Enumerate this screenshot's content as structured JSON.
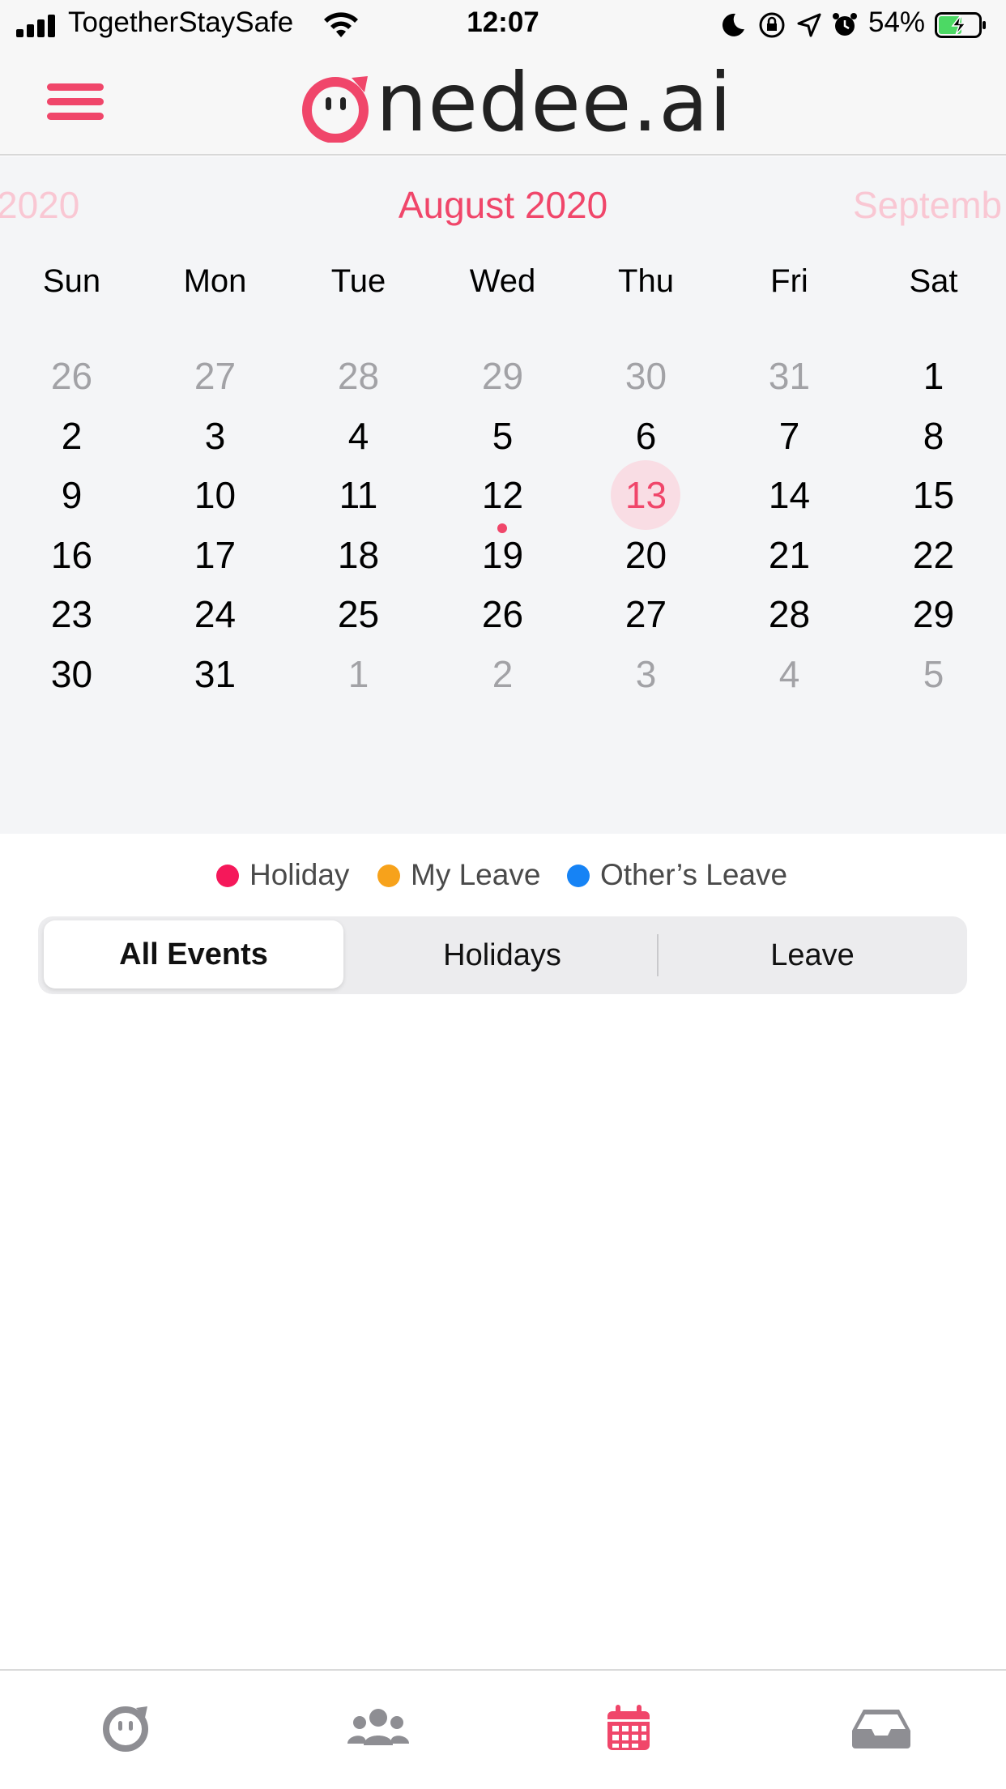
{
  "status_bar": {
    "carrier": "TogetherStaySafe",
    "time": "12:07",
    "battery": "54%",
    "icons": [
      "signal-icon",
      "wifi-icon",
      "moon-icon",
      "rotation-lock-icon",
      "location-icon",
      "alarm-icon",
      "battery-charging-icon"
    ]
  },
  "header": {
    "menu_icon": "hamburger-menu-icon",
    "logo_text": "nedee.ai",
    "brand_color": "#f0466a"
  },
  "calendar": {
    "prev_month": "2020",
    "current_month": "August 2020",
    "next_month": "Septemb",
    "weekdays": [
      "Sun",
      "Mon",
      "Tue",
      "Wed",
      "Thu",
      "Fri",
      "Sat"
    ],
    "weeks": [
      [
        "26",
        "27",
        "28",
        "29",
        "30",
        "31",
        "1"
      ],
      [
        "2",
        "3",
        "4",
        "5",
        "6",
        "7",
        "8"
      ],
      [
        "9",
        "10",
        "11",
        "12",
        "13",
        "14",
        "15"
      ],
      [
        "16",
        "17",
        "18",
        "19",
        "20",
        "21",
        "22"
      ],
      [
        "23",
        "24",
        "25",
        "26",
        "27",
        "28",
        "29"
      ],
      [
        "30",
        "31",
        "1",
        "2",
        "3",
        "4",
        "5"
      ]
    ],
    "today": "13",
    "event_day": "12"
  },
  "legend": [
    {
      "label": "Holiday",
      "color": "#f5185a"
    },
    {
      "label": "My Leave",
      "color": "#f7a21b"
    },
    {
      "label": "Other’s Leave",
      "color": "#1683f5"
    }
  ],
  "segments": {
    "all_events": "All Events",
    "holidays": "Holidays",
    "leave": "Leave",
    "selected": "All Events"
  },
  "tab_bar": {
    "tabs": [
      {
        "icon": "onedee-face-icon",
        "color": "#8e8e93"
      },
      {
        "icon": "people-group-icon",
        "color": "#8e8e93"
      },
      {
        "icon": "calendar-icon",
        "color": "#f0466a"
      },
      {
        "icon": "inbox-tray-icon",
        "color": "#8e8e93"
      }
    ],
    "active": "calendar-icon"
  }
}
